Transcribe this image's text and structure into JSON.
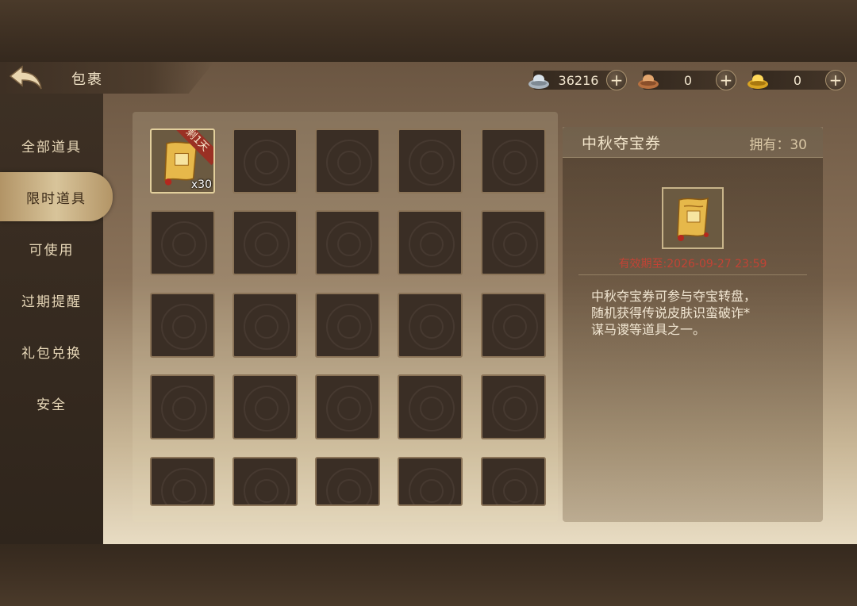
{
  "header": {
    "title": "包裹"
  },
  "currencies": [
    {
      "icon": "silver-ingot-icon",
      "value": "36216"
    },
    {
      "icon": "copper-ingot-icon",
      "value": "0"
    },
    {
      "icon": "gold-ingot-icon",
      "value": "0"
    }
  ],
  "sidebar": {
    "items": [
      {
        "label": "全部道具"
      },
      {
        "label": "限时道具"
      },
      {
        "label": "可使用"
      },
      {
        "label": "过期提醒"
      },
      {
        "label": "礼包兑换"
      },
      {
        "label": "安全"
      }
    ],
    "active_index": 1
  },
  "inventory": {
    "first_item": {
      "ribbon": "剩1天",
      "quantity": "x30",
      "icon": "treasure-scroll-icon"
    }
  },
  "detail": {
    "name": "中秋夺宝券",
    "owned": "拥有：30",
    "expiry": "有效期至:2026-09-27  23:59",
    "description": "中秋夺宝券可参与夺宝转盘，\n随机获得传说皮肤识蛮破诈*\n谋马谡等道具之一。"
  },
  "colors": {
    "accent": "#c24335",
    "active_tab": "#d8c49a"
  }
}
